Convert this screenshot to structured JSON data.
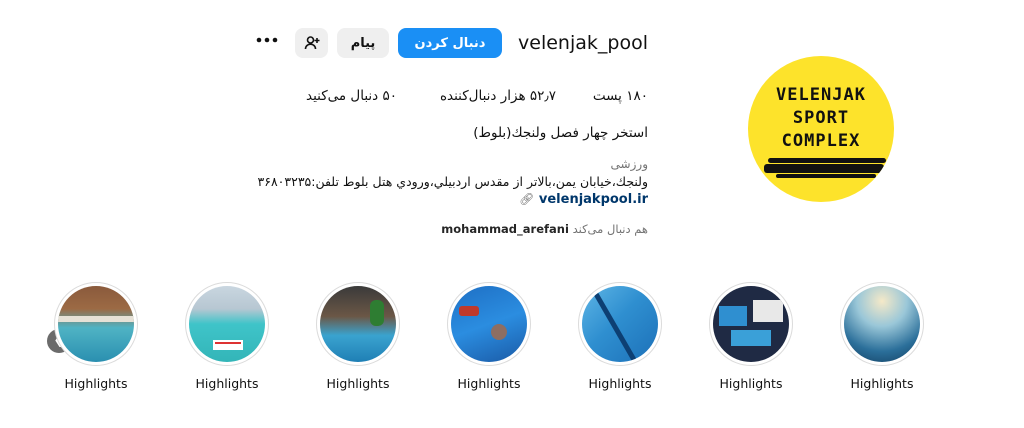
{
  "profile": {
    "username": "velenjak_pool",
    "avatar_text": [
      "VELENJAK",
      "SPORT",
      "COMPLEX"
    ],
    "buttons": {
      "follow": "دنبال کردن",
      "message": "پیام"
    },
    "icons": {
      "add_user": "add-user-icon",
      "more": "more-options-icon"
    },
    "stats": {
      "posts": "۱۸۰ پست",
      "followers": "۵۲٫۷ هزار دنبال‌کننده",
      "following": "۵۰ دنبال می‌کنید"
    },
    "bio": {
      "name": "استخر چهار فصل ولنجك(بلوط)",
      "category": "ورزشی",
      "address": "ولنجك،خيابان يمن،بالاتر از مقدس اردبيلي،ورودي هتل بلوط تلفن:۳۶۸۰۳۲۳۵",
      "link": "velenjakpool.ir"
    },
    "followed_by": {
      "prefix": "هم دنبال می‌کند",
      "user": "mohammad_arefani"
    }
  },
  "highlights": [
    {
      "label": "Highlights"
    },
    {
      "label": "Highlights"
    },
    {
      "label": "Highlights"
    },
    {
      "label": "Highlights"
    },
    {
      "label": "Highlights"
    },
    {
      "label": "Highlights"
    },
    {
      "label": "Highlights"
    }
  ],
  "colors": {
    "follow_button": "#1a8ff5",
    "avatar_bg": "#fde32b",
    "link": "#00376b"
  }
}
